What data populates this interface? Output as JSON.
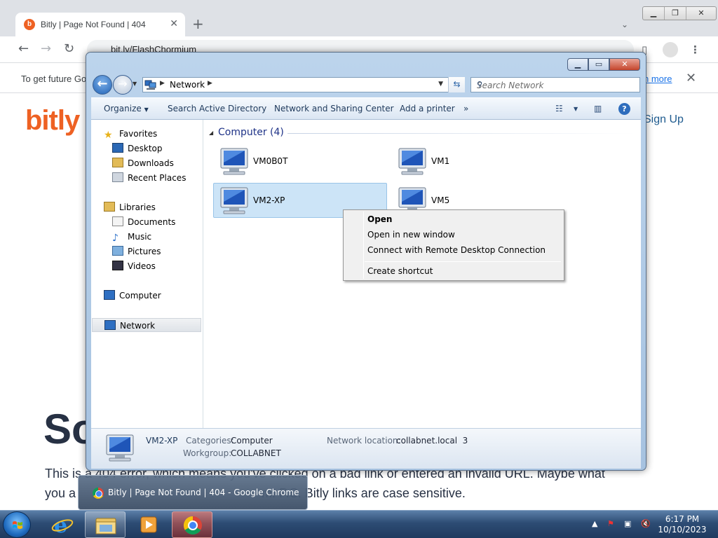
{
  "chrome": {
    "tab_title": "Bitly | Page Not Found | 404",
    "tab_close": "✕",
    "new_tab": "+",
    "url": "bit.ly/FlashChormium",
    "infobar_text": "To get future Go",
    "infobar_link": "n more",
    "infobar_close": "✕",
    "logo": "bitly",
    "signup": "Sign Up",
    "heading": "So",
    "paragraph_line1": "This is a 404 error, which means you've clicked on a bad link or entered an invalid URL. Maybe what",
    "paragraph_line2": "you a                                                     m. P.S. Bitly links are case sensitive."
  },
  "explorer": {
    "breadcrumb": "Network",
    "search_placeholder": "Search Network",
    "commands": [
      "Organize",
      "Search Active Directory",
      "Network and Sharing Center",
      "Add a printer"
    ],
    "more": "»",
    "nav": {
      "favorites": "Favorites",
      "desktop": "Desktop",
      "downloads": "Downloads",
      "recent": "Recent Places",
      "libraries": "Libraries",
      "documents": "Documents",
      "music": "Music",
      "pictures": "Pictures",
      "videos": "Videos",
      "computer": "Computer",
      "network": "Network"
    },
    "group_header": "Computer (4)",
    "computers": [
      "VM0B0T",
      "VM1",
      "VM2-XP",
      "VM5"
    ],
    "details": {
      "name": "VM2-XP",
      "categories_label": "Categories:",
      "categories_value": "Computer",
      "workgroup_label": "Workgroup:",
      "workgroup_value": "COLLABNET",
      "location_label": "Network location:",
      "location_value": "collabnet.local  3"
    }
  },
  "context_menu": {
    "open": "Open",
    "open_new_window": "Open in new window",
    "connect_rdp": "Connect with Remote Desktop Connection",
    "create_shortcut": "Create shortcut"
  },
  "taskbar": {
    "thumbnail_title": "Bitly | Page Not Found | 404 - Google Chrome",
    "time": "6:17 PM",
    "date": "10/10/2023"
  },
  "colors": {
    "bitly_orange": "#ee6123",
    "selection_blue": "#cce4f7",
    "link_blue": "#1e3287"
  }
}
